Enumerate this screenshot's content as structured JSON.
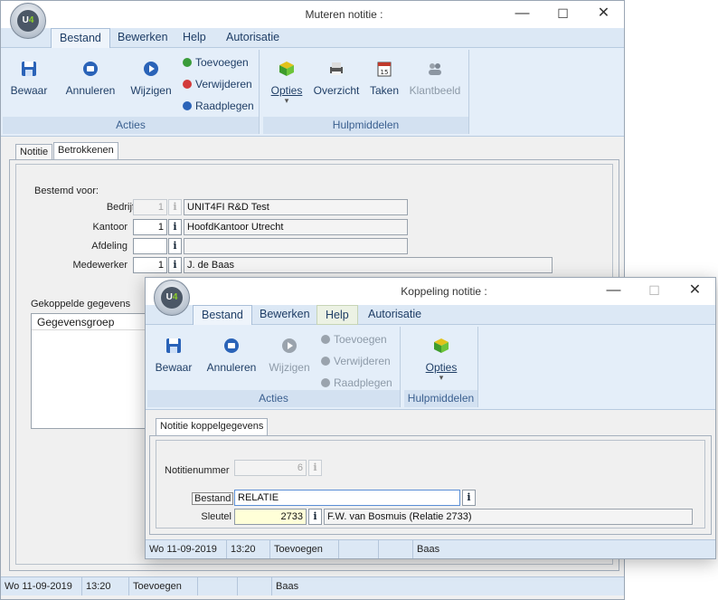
{
  "main": {
    "title": "Muteren notitie :",
    "menu": [
      "Bestand",
      "Bewerken",
      "Help",
      "Autorisatie"
    ],
    "ribbon": {
      "acties": {
        "label": "Acties",
        "bewaar": "Bewaar",
        "annuleren": "Annuleren",
        "wijzigen": "Wijzigen",
        "toevoegen": "Toevoegen",
        "verwijderen": "Verwijderen",
        "raadplegen": "Raadplegen"
      },
      "hulpmiddelen": {
        "label": "Hulpmiddelen",
        "opties": "Opties",
        "overzicht": "Overzicht",
        "taken": "Taken",
        "klantbeeld": "Klantbeeld"
      }
    },
    "tabs": [
      "Notitie",
      "Betrokkenen"
    ],
    "form": {
      "section": "Bestemd voor:",
      "bedrijf": {
        "label": "Bedrijf",
        "code": "1",
        "name": "UNIT4FI R&D Test"
      },
      "kantoor": {
        "label": "Kantoor",
        "code": "1",
        "name": "HoofdKantoor Utrecht"
      },
      "afdeling": {
        "label": "Afdeling",
        "code": "",
        "name": ""
      },
      "medewerker": {
        "label": "Medewerker",
        "code": "1",
        "name": "J. de Baas"
      }
    },
    "linked": {
      "title": "Gekoppelde gegevens",
      "column": "Gegevensgroep"
    },
    "status": {
      "date": "Wo 11-09-2019",
      "time": "13:20",
      "mode": "Toevoegen",
      "user": "Baas"
    }
  },
  "dialog": {
    "title": "Koppeling notitie :",
    "menu": [
      "Bestand",
      "Bewerken",
      "Help",
      "Autorisatie"
    ],
    "ribbon": {
      "acties": {
        "label": "Acties",
        "bewaar": "Bewaar",
        "annuleren": "Annuleren",
        "wijzigen": "Wijzigen",
        "toevoegen": "Toevoegen",
        "verwijderen": "Verwijderen",
        "raadplegen": "Raadplegen"
      },
      "hulpmiddelen": {
        "label": "Hulpmiddelen",
        "opties": "Opties"
      }
    },
    "tab": "Notitie koppelgegevens",
    "form": {
      "notitienummer": {
        "label": "Notitienummer",
        "value": "6"
      },
      "bestand": {
        "label": "Bestand",
        "value": "RELATIE"
      },
      "sleutel": {
        "label": "Sleutel",
        "value": "2733",
        "name": "F.W. van Bosmuis (Relatie 2733)"
      }
    },
    "status": {
      "date": "Wo 11-09-2019",
      "time": "13:20",
      "mode": "Toevoegen",
      "user": "Baas"
    }
  },
  "colors": {
    "ribbon": "#e4eef9",
    "menubar": "#dce8f5",
    "accent": "#1f3e66",
    "highlight_field": "#ffffd8"
  },
  "window_controls": {
    "minimize": "—",
    "maximize": "☐",
    "close": "✕"
  },
  "logo_text": {
    "u": "U",
    "four": "4"
  }
}
